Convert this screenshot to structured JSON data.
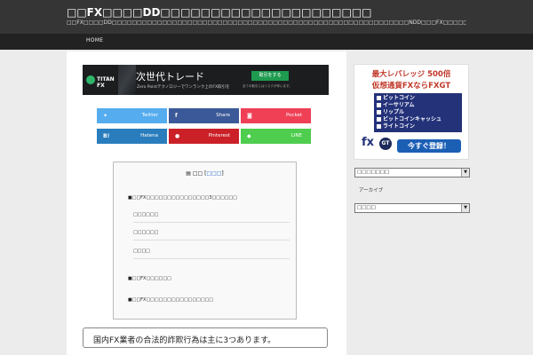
{
  "header": {
    "site_title": "□□FX□□□□DD□□□□□□□□□□□□□□□□□□□□□",
    "site_desc": "□□FX□□□□DD□□□□□□□□□□□□□□□□□□□□□□□□□□□□□□□□□□□□□□□□□□□□□□□□□□□□□□□□□□□NDD□□□FX□□□□□□□□",
    "nav_home": "HOME"
  },
  "banner": {
    "logo_text": "TITAN FX",
    "headline": "次世代トレード",
    "sub": "Zero Pointテクノロジーでワンランク上のFX取引を",
    "button": "取引をする",
    "note": "全ての取引にはリスクが伴います。"
  },
  "share": {
    "twitter": "Twitter",
    "facebook": "Share",
    "pocket": "Pocket",
    "hatena": "Hatena",
    "pinterest": "Pinterest",
    "line": "LINE",
    "twitter_icon": "twitter-icon",
    "facebook_icon": "facebook-icon",
    "pocket_icon": "pocket-icon",
    "hatena_icon_text": "B!",
    "pinterest_icon": "pinterest-icon",
    "line_icon": "line-icon"
  },
  "toc": {
    "title": "□□",
    "toggle": "□□□",
    "items": [
      "■□□FX□□□□□□□□□□□□□□□3□□□□□□",
      "□□□□□□",
      "□□□□□□",
      "□□□□",
      "■□□FX□□□□□□",
      "■□□FX□□□□□□□□□□□□□□□□"
    ]
  },
  "headline": "国内FX業者の合法的詐欺行為は主に3つあります。",
  "ad": {
    "line1": "最大レバレッジ 500倍",
    "line2": "仮想通貨FXならFXGT",
    "items": [
      "ビットコイン",
      "イーサリアム",
      "リップル",
      "ビットコインキャッシュ",
      "ライトコイン"
    ],
    "logo": "fx",
    "badge": "GT",
    "button": "今すぐ登録！"
  },
  "sidebar": {
    "select1": "□□□□□□□",
    "archive_label": "アーカイブ",
    "select2": "□□□□"
  },
  "colors": {
    "header_bg": "#353535",
    "nav_bg": "#222222",
    "twitter": "#55acee",
    "facebook": "#3b5998",
    "pocket": "#ef4056",
    "hatena": "#2a7dbd",
    "pinterest": "#cb2027",
    "line": "#4ecd4e",
    "ad_red": "#c0392b",
    "ad_blue": "#24327a"
  }
}
